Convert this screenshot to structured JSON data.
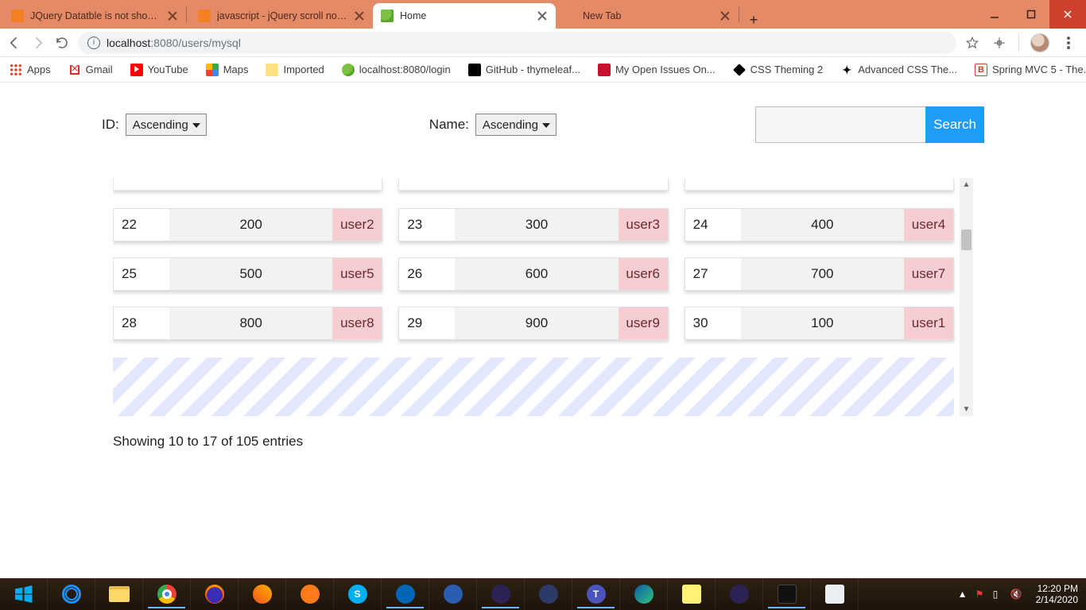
{
  "browser": {
    "tabs": [
      {
        "title": "JQuery Datatble is not showing d",
        "favicon": "so"
      },
      {
        "title": "javascript - jQuery scroll not work",
        "favicon": "so"
      },
      {
        "title": "Home",
        "favicon": "leaf",
        "active": true
      },
      {
        "title": "New Tab",
        "favicon": "blank"
      }
    ],
    "url": {
      "host": "localhost",
      "port": ":8080",
      "path": "/users/mysql"
    },
    "bookmarks": [
      {
        "label": "Apps",
        "icon": "apps"
      },
      {
        "label": "Gmail",
        "icon": "gmail"
      },
      {
        "label": "YouTube",
        "icon": "yt"
      },
      {
        "label": "Maps",
        "icon": "maps"
      },
      {
        "label": "Imported",
        "icon": "folder"
      },
      {
        "label": "localhost:8080/login",
        "icon": "leaf"
      },
      {
        "label": "GitHub - thymeleaf...",
        "icon": "gh"
      },
      {
        "label": "My Open Issues On...",
        "icon": "red"
      },
      {
        "label": "CSS Theming 2",
        "icon": "diamond"
      },
      {
        "label": "Advanced CSS The...",
        "icon": "bolt"
      },
      {
        "label": "Spring MVC 5 - The...",
        "icon": "b"
      }
    ]
  },
  "filters": {
    "id_label": "ID:",
    "id_value": "Ascending",
    "name_label": "Name:",
    "name_value": "Ascending",
    "search_button": "Search",
    "search_value": ""
  },
  "cards": [
    {
      "id": "22",
      "val": "200",
      "user": "user2"
    },
    {
      "id": "23",
      "val": "300",
      "user": "user3"
    },
    {
      "id": "24",
      "val": "400",
      "user": "user4"
    },
    {
      "id": "25",
      "val": "500",
      "user": "user5"
    },
    {
      "id": "26",
      "val": "600",
      "user": "user6"
    },
    {
      "id": "27",
      "val": "700",
      "user": "user7"
    },
    {
      "id": "28",
      "val": "800",
      "user": "user8"
    },
    {
      "id": "29",
      "val": "900",
      "user": "user9"
    },
    {
      "id": "30",
      "val": "100",
      "user": "user1"
    }
  ],
  "result_line": "Showing 10 to 17 of 105 entries",
  "taskbar": {
    "time": "12:20 PM",
    "date": "2/14/2020"
  }
}
